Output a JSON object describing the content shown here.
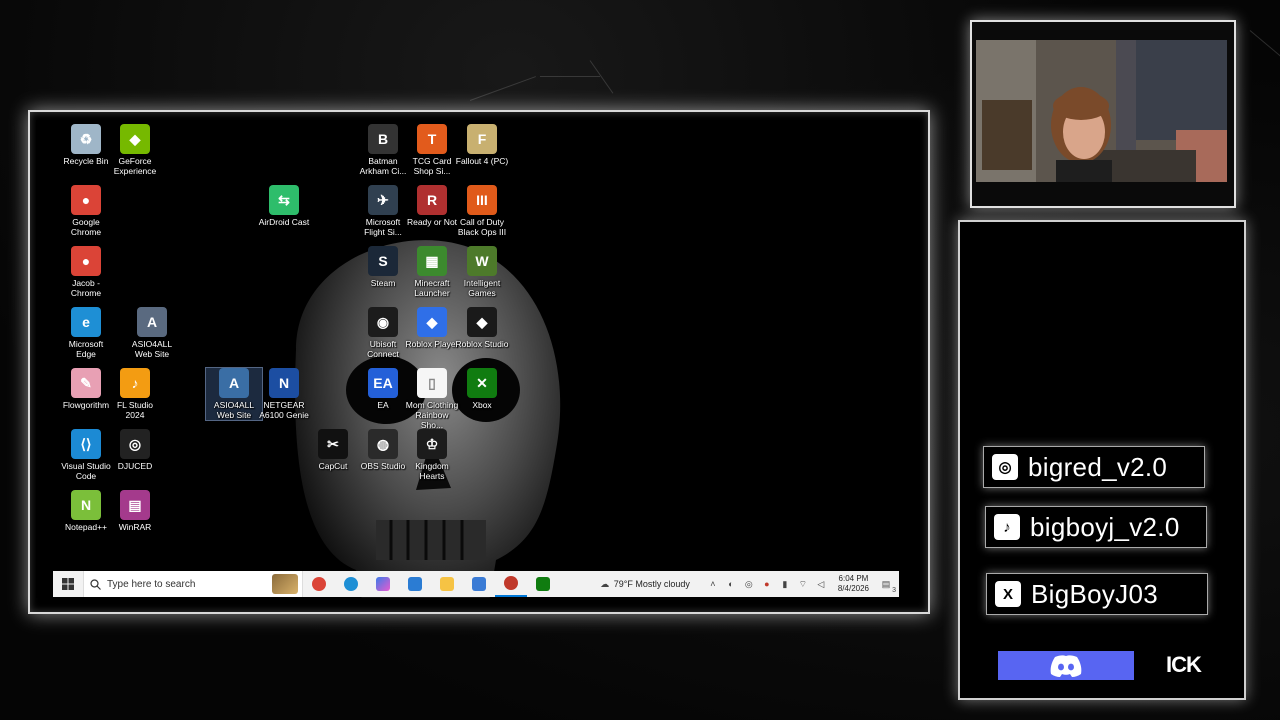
{
  "desktop": {
    "icons": [
      {
        "label": "Recycle Bin",
        "color": "#9fb6c8",
        "glyph": "♻"
      },
      {
        "label": "GeForce Experience",
        "color": "#76b900",
        "glyph": "◆"
      },
      {
        "label": "Google Chrome",
        "color": "#db4437",
        "glyph": "●"
      },
      {
        "label": "Jacob - Chrome",
        "color": "#db4437",
        "glyph": "●"
      },
      {
        "label": "Microsoft Edge",
        "color": "#1e8fd5",
        "glyph": "e"
      },
      {
        "label": "ASIO4ALL Web Site",
        "color": "#5a6a80",
        "glyph": "A"
      },
      {
        "label": "Flowgorithm",
        "color": "#e8a0b4",
        "glyph": "✎"
      },
      {
        "label": "FL Studio 2024",
        "color": "#f39c12",
        "glyph": "♪"
      },
      {
        "label": "Visual Studio Code",
        "color": "#1c8ad4",
        "glyph": "⟨⟩"
      },
      {
        "label": "DJUCED",
        "color": "#222222",
        "glyph": "◎"
      },
      {
        "label": "Notepad++",
        "color": "#7bbf3a",
        "glyph": "N"
      },
      {
        "label": "WinRAR",
        "color": "#a43a8c",
        "glyph": "▤"
      },
      {
        "label": "AirDroid Cast",
        "color": "#2ebd6b",
        "glyph": "⇆"
      },
      {
        "label": "ASIO4ALL Web Site",
        "color": "#3a6ea5",
        "glyph": "A"
      },
      {
        "label": "NETGEAR A6100 Genie",
        "color": "#1c4ea2",
        "glyph": "N"
      },
      {
        "label": "Batman Arkham Ci...",
        "color": "#333333",
        "glyph": "B"
      },
      {
        "label": "TCG Card Shop Si...",
        "color": "#e25b1c",
        "glyph": "T"
      },
      {
        "label": "Fallout 4 (PC)",
        "color": "#c8b070",
        "glyph": "F"
      },
      {
        "label": "Microsoft Flight Si...",
        "color": "#304050",
        "glyph": "✈"
      },
      {
        "label": "Ready or Not",
        "color": "#b03030",
        "glyph": "R"
      },
      {
        "label": "Call of Duty Black Ops III",
        "color": "#e05a1a",
        "glyph": "III"
      },
      {
        "label": "Steam",
        "color": "#1b2838",
        "glyph": "S"
      },
      {
        "label": "Minecraft Launcher",
        "color": "#3c8a2e",
        "glyph": "▦"
      },
      {
        "label": "Intelligent Games",
        "color": "#4d7a2a",
        "glyph": "W"
      },
      {
        "label": "Ubisoft Connect",
        "color": "#1c1c1c",
        "glyph": "◉"
      },
      {
        "label": "Roblox Player",
        "color": "#2f6fe8",
        "glyph": "◆"
      },
      {
        "label": "Roblox Studio",
        "color": "#1a1a1a",
        "glyph": "◆"
      },
      {
        "label": "EA",
        "color": "#2460d8",
        "glyph": "EA"
      },
      {
        "label": "Mom Clothing Rainbow Sho...",
        "color": "#f6f6f6",
        "glyph": "▯"
      },
      {
        "label": "Xbox",
        "color": "#107c10",
        "glyph": "✕"
      },
      {
        "label": "CapCut",
        "color": "#111111",
        "glyph": "✂"
      },
      {
        "label": "OBS Studio",
        "color": "#2a2a2a",
        "glyph": "◍"
      },
      {
        "label": "Kingdom Hearts",
        "color": "#1c1c1c",
        "glyph": "♔"
      }
    ],
    "taskbar": {
      "search_placeholder": "Type here to search",
      "weather": "79°F  Mostly cloudy",
      "time": "6:04 PM",
      "date": "8/4/2026",
      "notification_count": "3"
    }
  },
  "social": {
    "instagram": "bigred_v2.0",
    "tiktok": "bigboyj_v2.0",
    "x": "BigBoyJ03",
    "ick": "ICK"
  },
  "colors": {
    "discord": "#5865f2",
    "taskbar": "#f2f2f2"
  }
}
